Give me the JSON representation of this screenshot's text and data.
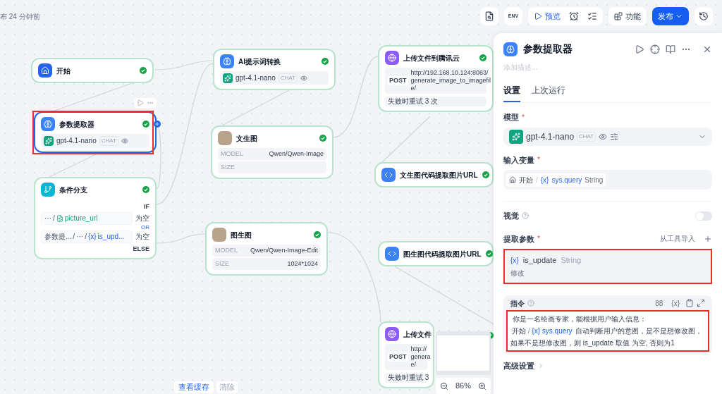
{
  "header": {
    "status": "布 24 分钟前"
  },
  "toolbar": {
    "env": "ENV",
    "preview": "预览",
    "features": "功能",
    "publish": "发布"
  },
  "nodes": [
    {
      "kind": "start",
      "title": "开始",
      "selected": false
    },
    {
      "kind": "llm",
      "title": "AI提示词转换",
      "model": "gpt-4.1-nano",
      "mode": "CHAT",
      "selected": false
    },
    {
      "kind": "llm",
      "title": "参数提取器",
      "model": "gpt-4.1-nano",
      "mode": "CHAT",
      "selected": true
    },
    {
      "kind": "image",
      "title": "文生图",
      "rows": [
        {
          "label": "MODEL",
          "value": "Qwen/Qwen-Image"
        },
        {
          "label": "SIZE",
          "value": ""
        }
      ],
      "selected": false
    },
    {
      "kind": "http",
      "title": "上传文件到腾讯云",
      "method": "POST",
      "url": [
        "http://192.168.10.124:8083/",
        "generate_image_to_imagefil",
        "e/"
      ],
      "retry": "失败时重试 3 次",
      "selected": false
    },
    {
      "kind": "code",
      "title": "文生图代码提取图片URL",
      "selected": false
    },
    {
      "kind": "branch",
      "title": "条件分支",
      "if": "IF",
      "else": "ELSE",
      "join": "OR",
      "conditions": [
        {
          "kind": "file",
          "segments": [
            "···",
            "/"
          ],
          "var": "picture_url",
          "op": "为空"
        },
        {
          "kind": "variable",
          "segments": [
            "参数提...",
            "/",
            "···",
            "/"
          ],
          "var_icon": "{x}",
          "var": "is_upd...",
          "op": "为空"
        }
      ],
      "selected": false
    },
    {
      "kind": "image",
      "title": "图生图",
      "rows": [
        {
          "label": "MODEL",
          "value": "Qwen/Qwen-Image-Edit"
        },
        {
          "label": "SIZE",
          "value": "1024*1024"
        }
      ],
      "selected": false
    },
    {
      "kind": "code",
      "title": "图生图代码提取图片URL",
      "selected": false
    },
    {
      "kind": "http",
      "title": "上传文件",
      "method": "POST",
      "url": [
        "http://",
        "genera",
        "e/"
      ],
      "retry": "失败时重试 3",
      "selected": false
    }
  ],
  "cache": {
    "view": "查看缓存",
    "clear": "清除"
  },
  "minimap": {
    "zoom": "86%"
  },
  "panel": {
    "title": "参数提取器",
    "description_placeholder": "添加描述...",
    "tabs": [
      {
        "label": "设置",
        "selected": true
      },
      {
        "label": "上次运行",
        "selected": false
      }
    ],
    "model": {
      "label": "模型",
      "required": "*",
      "model": "gpt-4.1-nano",
      "mode": "CHAT"
    },
    "input": {
      "label": "输入变量",
      "required": "*",
      "node": "开始",
      "sep": "/",
      "var_icon": "{x}",
      "var": "sys.query",
      "type": "String"
    },
    "vision": {
      "label": "视觉",
      "on": false
    },
    "params": {
      "label": "提取参数",
      "required": "*",
      "import": "从工具导入",
      "items": [
        {
          "var_icon": "{x}",
          "name": "is_update",
          "type": "String",
          "description": "修改"
        }
      ]
    },
    "instruction": {
      "label": "指令",
      "count": "88",
      "insert_icon": "{x}",
      "lead": "你是一名绘画专家，能根据用户输入信息：",
      "node": "开始",
      "sep": "/",
      "var_icon": "{x}",
      "var": "sys.query",
      "rest": "自动判断用户的意图，是不是想修改图，如果不是想修改图，则 is_update 取值 为空, 否则为1"
    },
    "advanced": "高级设置"
  }
}
